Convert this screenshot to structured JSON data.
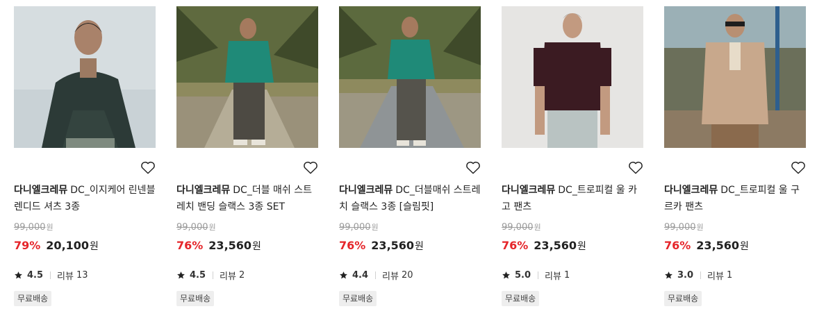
{
  "products": [
    {
      "brand": "다니엘크레뮤",
      "name": "DC_이지케어 린넨블렌디드 셔츠 3종",
      "original_price": "99,000",
      "original_unit": "원",
      "discount": "79%",
      "price": "20,100",
      "price_unit": "원",
      "rating": "4.5",
      "review_label": "리뷰",
      "review_count": "13",
      "badge": "무료배송"
    },
    {
      "brand": "다니엘크레뮤",
      "name": "DC_더블 매쉬 스트레치 밴딩 슬랙스 3종 SET",
      "original_price": "99,000",
      "original_unit": "원",
      "discount": "76%",
      "price": "23,560",
      "price_unit": "원",
      "rating": "4.5",
      "review_label": "리뷰",
      "review_count": "2",
      "badge": "무료배송"
    },
    {
      "brand": "다니엘크레뮤",
      "name": "DC_더블매쉬 스트레치 슬랙스 3종 [슬림핏]",
      "original_price": "99,000",
      "original_unit": "원",
      "discount": "76%",
      "price": "23,560",
      "price_unit": "원",
      "rating": "4.4",
      "review_label": "리뷰",
      "review_count": "20",
      "badge": "무료배송"
    },
    {
      "brand": "다니엘크레뮤",
      "name": "DC_트로피컬 울 카고 팬츠",
      "original_price": "99,000",
      "original_unit": "원",
      "discount": "76%",
      "price": "23,560",
      "price_unit": "원",
      "rating": "5.0",
      "review_label": "리뷰",
      "review_count": "1",
      "badge": "무료배송"
    },
    {
      "brand": "다니엘크레뮤",
      "name": "DC_트로피컬 울 구르카 팬츠",
      "original_price": "99,000",
      "original_unit": "원",
      "discount": "76%",
      "price": "23,560",
      "price_unit": "원",
      "rating": "3.0",
      "review_label": "리뷰",
      "review_count": "1",
      "badge": "무료배송"
    }
  ],
  "colors": {
    "discount": "#e5252a",
    "text": "#222222",
    "muted": "#9a9a9a",
    "badge_bg": "#eeeeee"
  },
  "icons": {
    "wishlist": "heart-outline-icon",
    "rating": "star-icon"
  }
}
